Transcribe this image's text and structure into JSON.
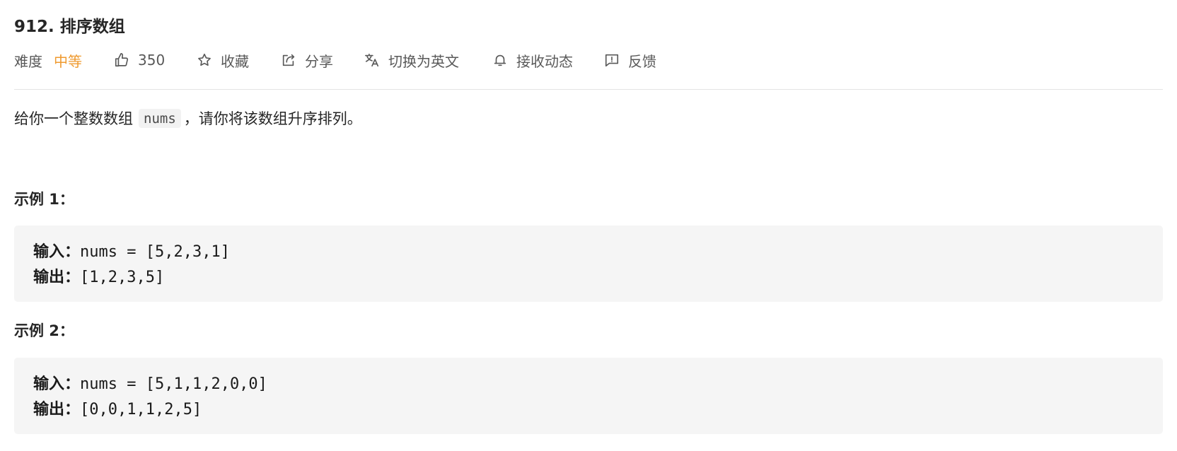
{
  "problem": {
    "title": "912. 排序数组"
  },
  "meta": {
    "difficulty_label": "难度",
    "difficulty_value": "中等",
    "likes": "350",
    "favorite_label": "收藏",
    "share_label": "分享",
    "switch_lang_label": "切换为英文",
    "subscribe_label": "接收动态",
    "feedback_label": "反馈",
    "difficulty_color": "#ef9a2f"
  },
  "description": {
    "before": "给你一个整数数组",
    "code": "nums",
    "after": "，请你将该数组升序排列。"
  },
  "examples": [
    {
      "heading": "示例 1：",
      "input_label": "输入：",
      "input_value": "nums = [5,2,3,1]",
      "output_label": "输出：",
      "output_value": "[1,2,3,5]"
    },
    {
      "heading": "示例 2：",
      "input_label": "输入：",
      "input_value": "nums = [5,1,1,2,0,0]",
      "output_label": "输出：",
      "output_value": "[0,0,1,1,2,5]"
    }
  ]
}
